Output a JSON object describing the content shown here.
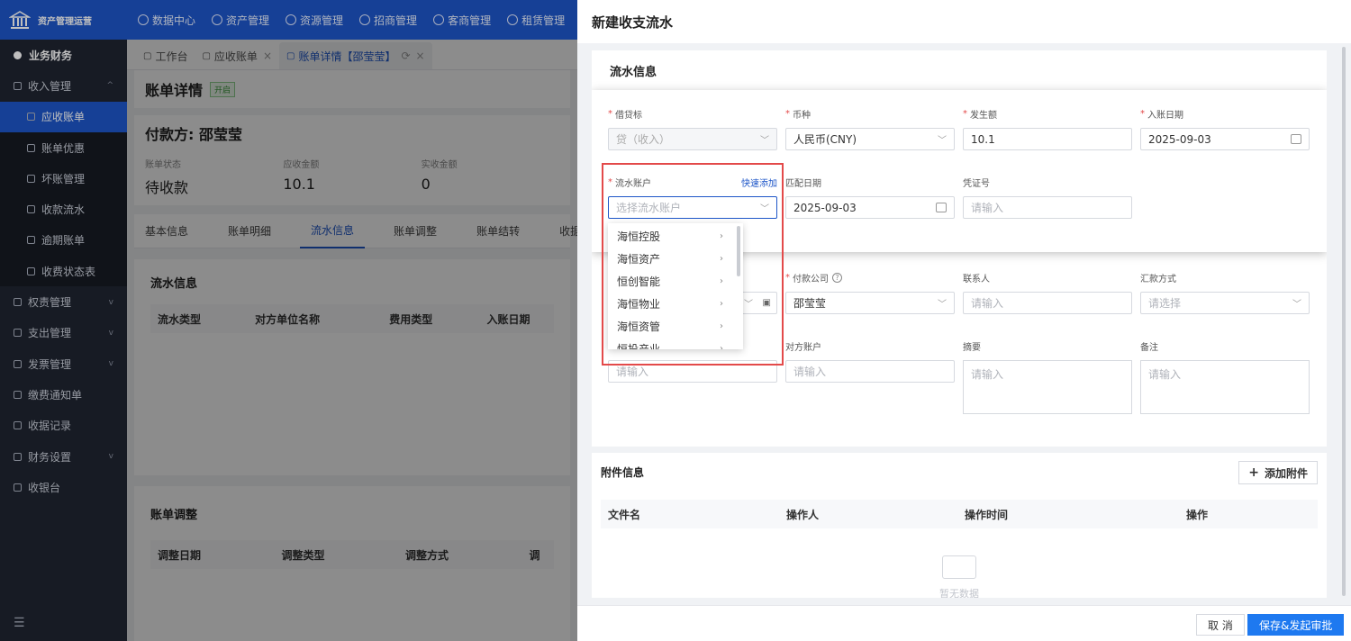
{
  "app": {
    "title": "资产管理运营"
  },
  "topnav": [
    "数据中心",
    "资产管理",
    "资源管理",
    "招商管理",
    "客商管理",
    "租赁管理"
  ],
  "sidebar": {
    "items": [
      {
        "label": "业务财务",
        "kind": "top"
      },
      {
        "label": "收入管理",
        "kind": "group",
        "arrow": "^"
      },
      {
        "label": "应收账单",
        "kind": "sub",
        "active": true
      },
      {
        "label": "账单优惠",
        "kind": "sub"
      },
      {
        "label": "坏账管理",
        "kind": "sub"
      },
      {
        "label": "收款流水",
        "kind": "sub"
      },
      {
        "label": "逾期账单",
        "kind": "sub"
      },
      {
        "label": "收费状态表",
        "kind": "sub"
      },
      {
        "label": "权责管理",
        "kind": "group",
        "arrow": "v"
      },
      {
        "label": "支出管理",
        "kind": "group",
        "arrow": "v"
      },
      {
        "label": "发票管理",
        "kind": "group",
        "arrow": "v"
      },
      {
        "label": "缴费通知单",
        "kind": "group"
      },
      {
        "label": "收据记录",
        "kind": "group"
      },
      {
        "label": "财务设置",
        "kind": "group",
        "arrow": "v"
      },
      {
        "label": "收银台",
        "kind": "group"
      }
    ]
  },
  "tabs": [
    {
      "label": "工作台",
      "active": false
    },
    {
      "label": "应收账单",
      "active": false,
      "closable": true
    },
    {
      "label": "账单详情【邵莹莹】",
      "active": true,
      "closable": true
    }
  ],
  "detail": {
    "title": "账单详情",
    "badge": "开启",
    "payer": "付款方: 邵莹莹",
    "stats": [
      {
        "label": "账单状态",
        "value": "待收款"
      },
      {
        "label": "应收金额",
        "value": "10.1"
      },
      {
        "label": "实收金额",
        "value": "0"
      }
    ],
    "subtabs": [
      "基本信息",
      "账单明细",
      "流水信息",
      "账单调整",
      "账单结转",
      "收据记录"
    ],
    "active_subtab": "流水信息",
    "flow_section": {
      "title": "流水信息",
      "columns": [
        "流水类型",
        "对方单位名称",
        "费用类型",
        "入账日期"
      ]
    },
    "adjust_section": {
      "title": "账单调整",
      "columns": [
        "调整日期",
        "调整类型",
        "调整方式",
        "调"
      ]
    }
  },
  "drawer": {
    "title": "新建收支流水",
    "panel_title": "流水信息",
    "fields": {
      "debit_credit": {
        "label": "借贷标",
        "value": "贷（收入）",
        "required": true
      },
      "currency": {
        "label": "币种",
        "value": "人民币(CNY)",
        "required": true
      },
      "amount": {
        "label": "发生额",
        "value": "10.1",
        "required": true
      },
      "post_date": {
        "label": "入账日期",
        "value": "2025-09-03",
        "required": true
      },
      "account": {
        "label": "流水账户",
        "placeholder": "选择流水账户",
        "required": true,
        "quick_add": "快速添加"
      },
      "match_date": {
        "label": "匹配日期",
        "value": "2025-09-03"
      },
      "voucher": {
        "label": "凭证号",
        "placeholder": "请输入"
      },
      "pay_company": {
        "label": "付款公司",
        "value": "邵莹莹",
        "required": true,
        "help": "?"
      },
      "contact": {
        "label": "联系人",
        "placeholder": "请输入"
      },
      "remit_method": {
        "label": "汇款方式",
        "placeholder": "请选择"
      },
      "counter_account": {
        "label": "对方账户",
        "placeholder": "请输入"
      },
      "summary": {
        "label": "摘要",
        "placeholder": "请输入"
      },
      "remark": {
        "label": "备注",
        "placeholder": "请输入"
      },
      "extra_input": {
        "placeholder": "请输入"
      }
    },
    "dropdown": {
      "options": [
        "海恒控股",
        "海恒资产",
        "恒创智能",
        "海恒物业",
        "海恒资管",
        "恒投产业"
      ]
    },
    "attachments": {
      "title": "附件信息",
      "add_label": "添加附件",
      "columns": [
        "文件名",
        "操作人",
        "操作时间",
        "操作"
      ],
      "empty_text": "暂无数据"
    },
    "footer": {
      "cancel": "取 消",
      "submit": "保存&发起审批"
    }
  }
}
